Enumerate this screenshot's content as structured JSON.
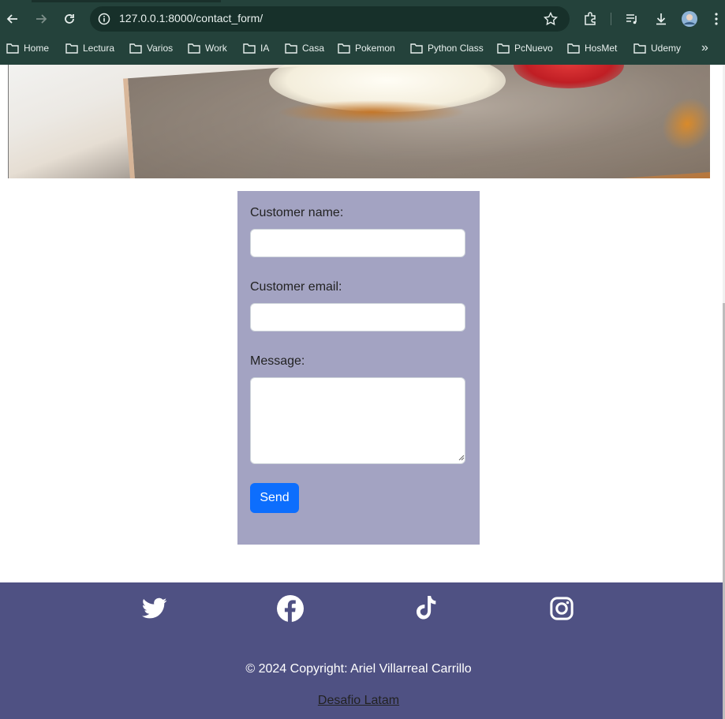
{
  "browser": {
    "url": "127.0.0.1:8000/contact_form/",
    "nav": {
      "back_icon": "back-arrow-icon",
      "forward_icon": "forward-arrow-icon",
      "reload_icon": "reload-icon"
    },
    "bookmarks": [
      "Home",
      "Lectura",
      "Varios",
      "Work",
      "IA",
      "Casa",
      "Pokemon",
      "Python Class",
      "PcNuevo",
      "HosMet",
      "Udemy"
    ],
    "bookmarks_overflow": "»"
  },
  "form": {
    "name_label": "Customer name:",
    "name_value": "",
    "email_label": "Customer email:",
    "email_value": "",
    "message_label": "Message:",
    "message_value": "",
    "send_label": "Send"
  },
  "footer": {
    "social_icons": [
      "twitter-icon",
      "facebook-icon",
      "tiktok-icon",
      "instagram-icon"
    ],
    "copyright": "© 2024 Copyright: Ariel Villarreal Carrillo",
    "link": "Desafio Latam"
  },
  "colors": {
    "chrome": "#24423b",
    "card": "#a3a3c2",
    "button": "#0d6efd",
    "footer": "#4f5183"
  }
}
